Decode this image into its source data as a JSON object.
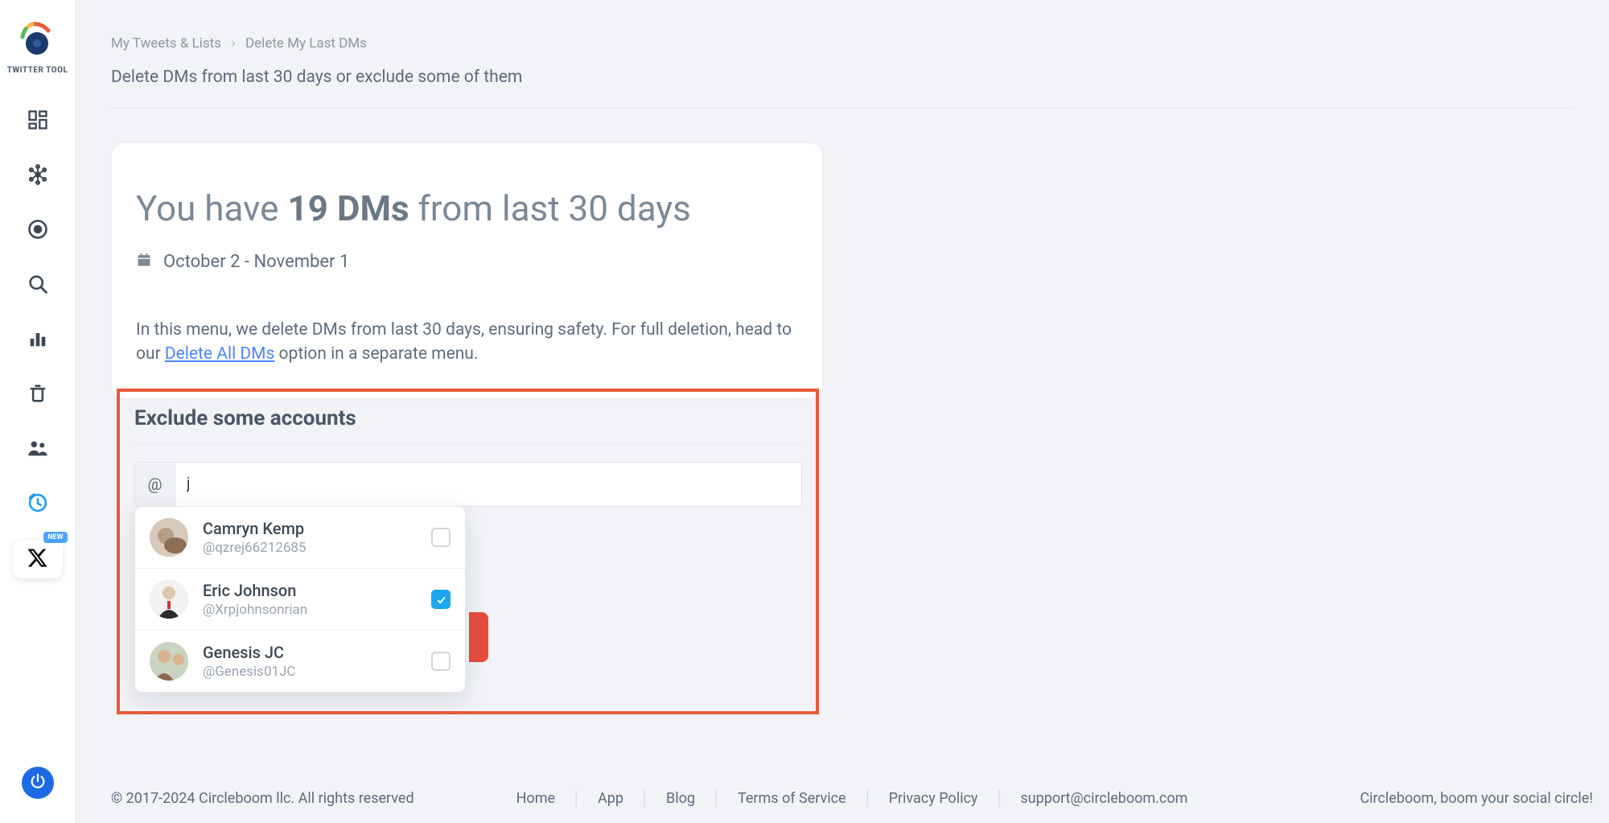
{
  "app_title": "TWITTER TOOL",
  "breadcrumbs": {
    "parent": "My Tweets & Lists",
    "current": "Delete My Last DMs"
  },
  "subtitle": "Delete DMs from last 30 days or exclude some of them",
  "headline": {
    "pre": "You have ",
    "count": "19 DMs",
    "post": " from last 30 days"
  },
  "date_range": "October 2 - November 1",
  "description": {
    "line1": "In this menu, we delete DMs from last 30 days, ensuring safety. For full deletion, head to our ",
    "link_text": "Delete All DMs",
    "line2": " option in a separate menu."
  },
  "exclude": {
    "title": "Exclude some accounts",
    "prefix": "@",
    "input_value": "j"
  },
  "options": [
    {
      "name": "Camryn Kemp",
      "handle": "@qzrej66212685",
      "checked": false
    },
    {
      "name": "Eric Johnson",
      "handle": "@Xrpjohnsonrian",
      "checked": true
    },
    {
      "name": "Genesis JC",
      "handle": "@Genesis01JC",
      "checked": false
    }
  ],
  "sidebar": {
    "new_badge": "NEW"
  },
  "footer": {
    "copyright": "© 2017-2024 Circleboom llc. All rights reserved",
    "links": [
      "Home",
      "App",
      "Blog",
      "Terms of Service",
      "Privacy Policy",
      "support@circleboom.com"
    ],
    "tagline": "Circleboom, boom your social circle!"
  }
}
